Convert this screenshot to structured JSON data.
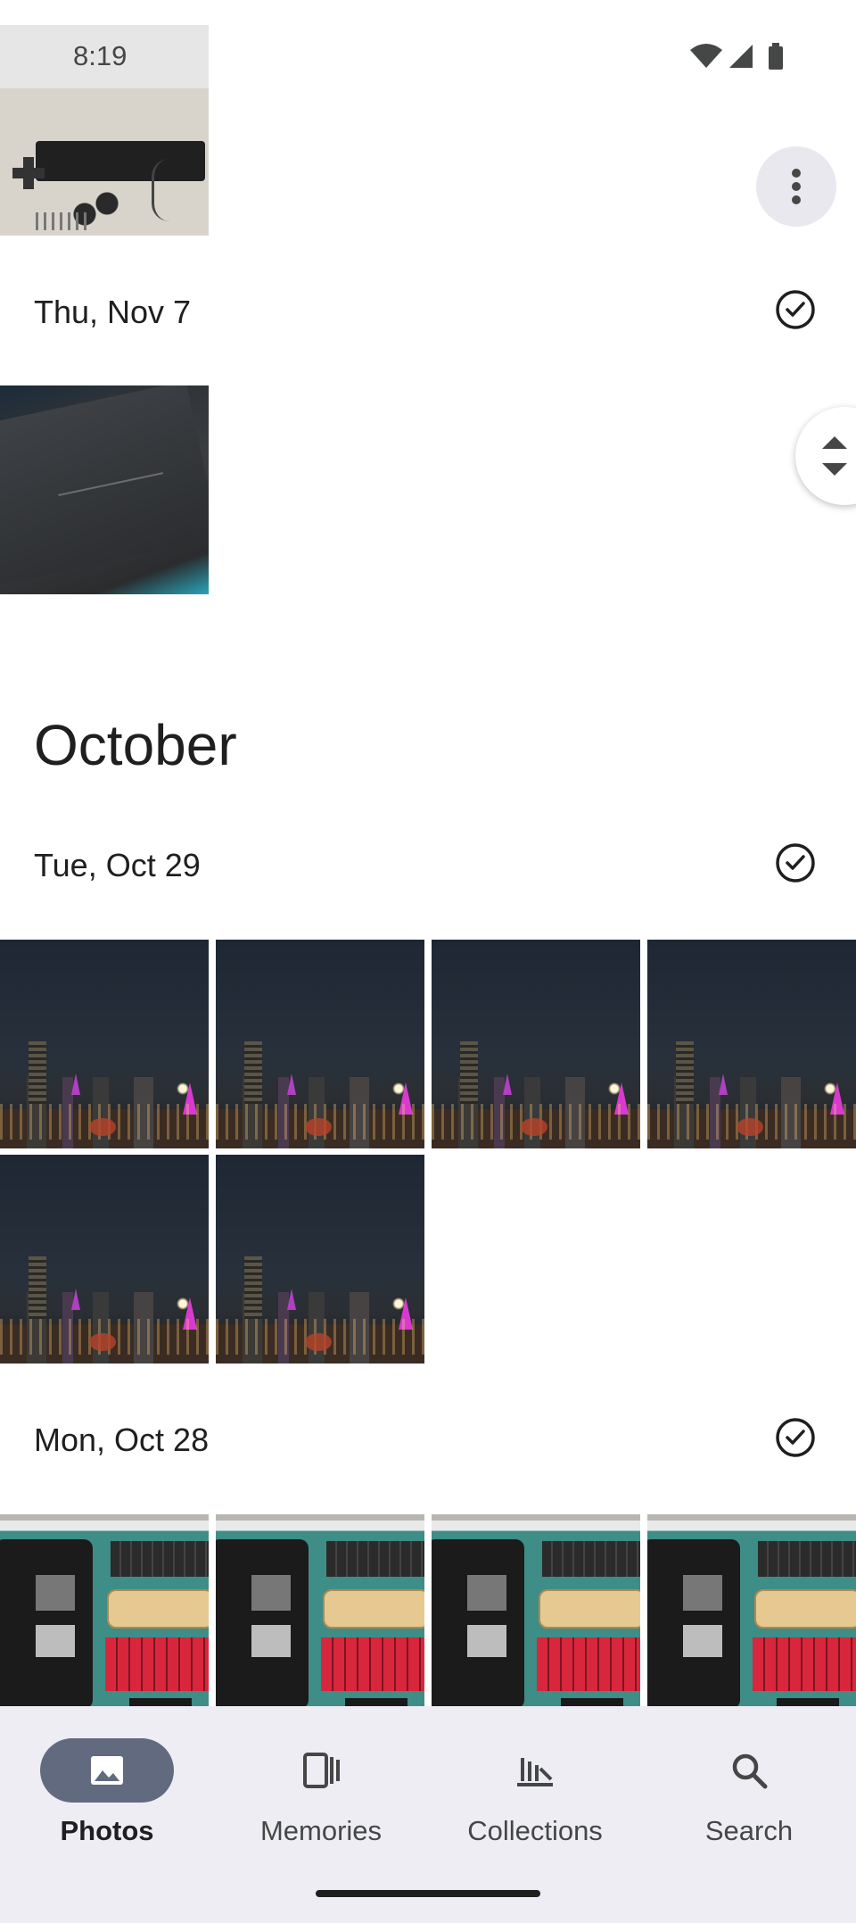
{
  "status_bar": {
    "time": "8:19",
    "icons": [
      "wifi-icon",
      "cellular-signal-icon",
      "battery-icon"
    ]
  },
  "toolbar": {
    "more_options_icon": "more-vert-icon"
  },
  "timeline": {
    "sections": [
      {
        "date": "Thu, Nov 7",
        "photos": [
          "rog-phone-box"
        ]
      },
      {
        "month": "October",
        "date": "Tue, Oct 29",
        "photos": [
          "city-night-1",
          "city-night-2",
          "city-night-3",
          "city-night-4",
          "city-night-5",
          "city-night-6"
        ]
      },
      {
        "date": "Mon, Oct 28",
        "photos": [
          "keyboard-kit-1",
          "keyboard-kit-2",
          "keyboard-kit-3",
          "keyboard-kit-4"
        ]
      }
    ],
    "top_partial_photo": "game-boy"
  },
  "scroll_handle_icon": "drag-up-down-icon",
  "bottom_nav": {
    "items": [
      {
        "label": "Photos",
        "icon": "photo-icon",
        "active": true
      },
      {
        "label": "Memories",
        "icon": "memories-icon",
        "active": false
      },
      {
        "label": "Collections",
        "icon": "collections-icon",
        "active": false
      },
      {
        "label": "Search",
        "icon": "search-icon",
        "active": false
      }
    ]
  },
  "colors": {
    "nav_background": "#eeedf4",
    "active_pill": "#626a80",
    "text_primary": "#1f1f1f"
  }
}
